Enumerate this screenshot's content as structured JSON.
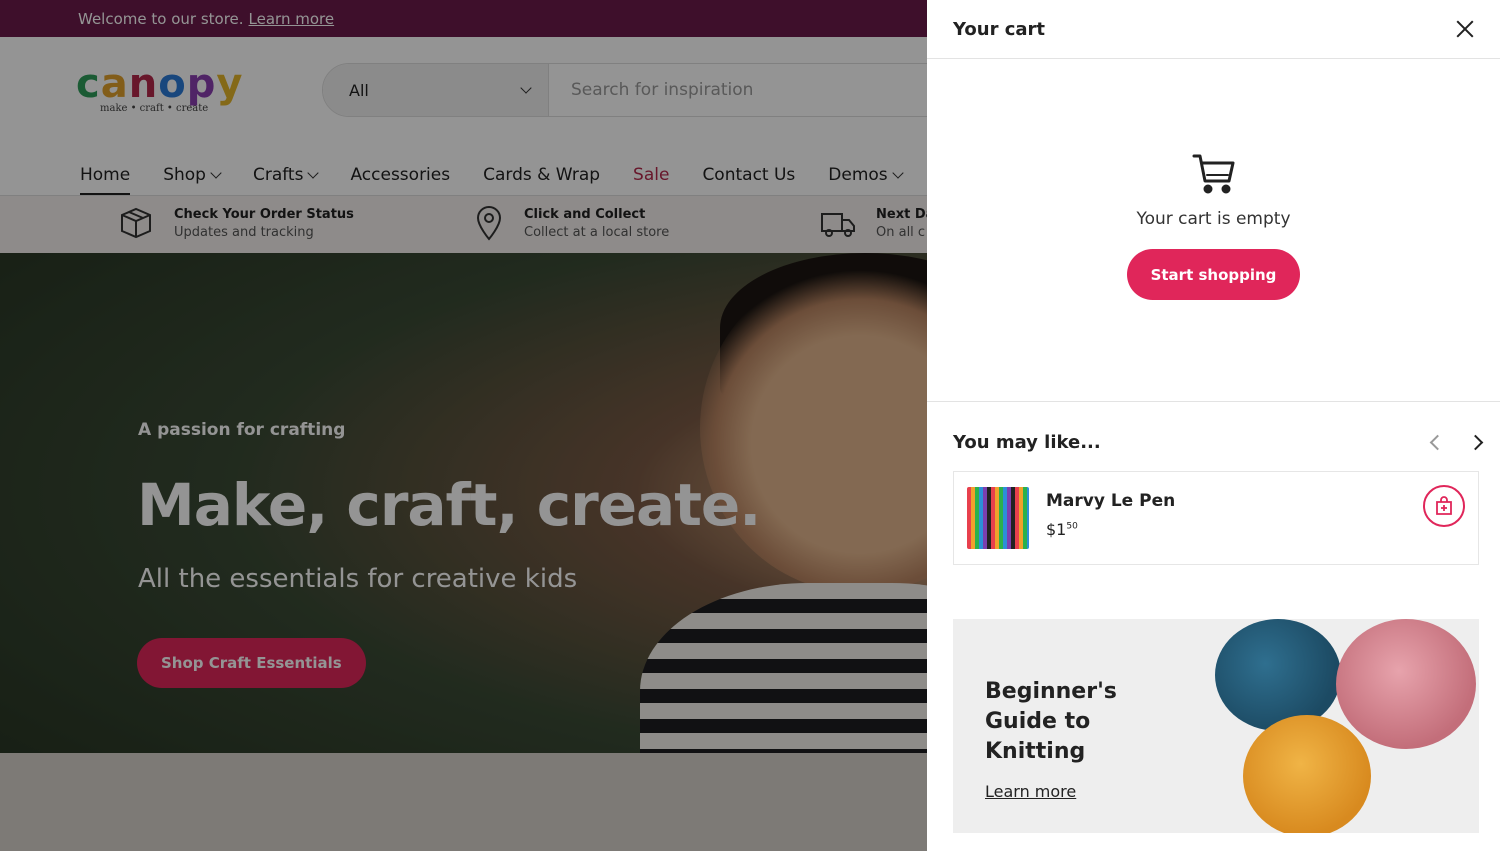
{
  "announcement": {
    "text": "Welcome to our store.",
    "link": "Learn more"
  },
  "logo": {
    "word": "canopy",
    "tagline": "make • craft • create"
  },
  "search": {
    "category": "All",
    "placeholder": "Search for inspiration"
  },
  "nav": {
    "home": "Home",
    "shop": "Shop",
    "crafts": "Crafts",
    "accessories": "Accessories",
    "cards": "Cards & Wrap",
    "sale": "Sale",
    "contact": "Contact Us",
    "demos": "Demos"
  },
  "info": [
    {
      "title": "Check Your Order Status",
      "sub": "Updates and tracking"
    },
    {
      "title": "Click and Collect",
      "sub": "Collect at a local store"
    },
    {
      "title": "Next Da",
      "sub": "On all c"
    }
  ],
  "hero": {
    "eyebrow": "A passion for crafting",
    "title": "Make, craft, create.",
    "subtitle": "All the essentials for creative kids",
    "button": "Shop Craft Essentials"
  },
  "cart": {
    "title": "Your cart",
    "empty_text": "Your cart is empty",
    "start_button": "Start shopping",
    "you_may_like": "You may like...",
    "product": {
      "name": "Marvy Le Pen",
      "price_main": "$1",
      "price_cents": "50"
    },
    "guide": {
      "title": "Beginner's Guide to Knitting",
      "link": "Learn more"
    }
  },
  "colors": {
    "accent": "#e0265a",
    "announce_bar": "#6b1a4a",
    "sale": "#b3284b"
  }
}
